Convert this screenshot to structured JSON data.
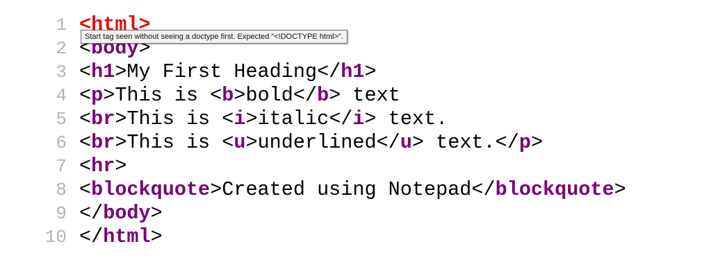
{
  "colors": {
    "tag": "#7a007a",
    "error_tag": "#e01010",
    "line_number": "#b4b4b4",
    "text": "#000000",
    "tooltip_bg": "#f2f2f2"
  },
  "tooltip": {
    "text": "Start tag seen without seeing a doctype first. Expected “<!DOCTYPE html>”."
  },
  "lines": [
    {
      "num": "1",
      "parts": [
        "<",
        "html",
        ">"
      ]
    },
    {
      "num": "2",
      "parts": [
        "<",
        "body",
        ">"
      ]
    },
    {
      "num": "3",
      "parts": [
        "<",
        "h1",
        ">My First Heading</",
        "h1",
        ">"
      ]
    },
    {
      "num": "4",
      "parts": [
        "<",
        "p",
        ">This is <",
        "b",
        ">bold</",
        "b",
        "> text"
      ]
    },
    {
      "num": "5",
      "parts": [
        "<",
        "br",
        ">This is <",
        "i",
        ">italic</",
        "i",
        "> text."
      ]
    },
    {
      "num": "6",
      "parts": [
        "<",
        "br",
        ">This is <",
        "u",
        ">underlined</",
        "u",
        "> text.</",
        "p",
        ">"
      ]
    },
    {
      "num": "7",
      "parts": [
        "<",
        "hr",
        ">"
      ]
    },
    {
      "num": "8",
      "parts": [
        "<",
        "blockquote",
        ">Created using Notepad</",
        "blockquote",
        ">"
      ]
    },
    {
      "num": "9",
      "parts": [
        "</",
        "body",
        ">"
      ]
    },
    {
      "num": "10",
      "parts": [
        "</",
        "html",
        ">"
      ]
    }
  ]
}
